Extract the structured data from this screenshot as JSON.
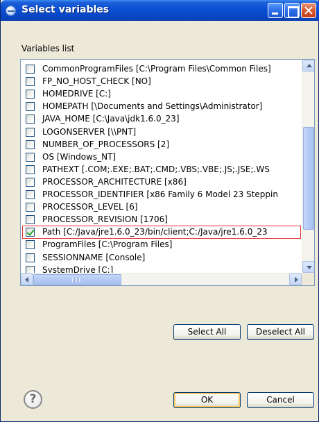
{
  "window": {
    "title": "Select variables"
  },
  "list": {
    "label": "Variables list",
    "items": [
      {
        "text": "CommonProgramFiles [C:\\Program Files\\Common Files]",
        "checked": false
      },
      {
        "text": "FP_NO_HOST_CHECK [NO]",
        "checked": false
      },
      {
        "text": "HOMEDRIVE [C:]",
        "checked": false
      },
      {
        "text": "HOMEPATH [\\Documents and Settings\\Administrator]",
        "checked": false
      },
      {
        "text": "JAVA_HOME [C:\\Java\\jdk1.6.0_23]",
        "checked": false
      },
      {
        "text": "LOGONSERVER [\\\\PNT]",
        "checked": false
      },
      {
        "text": "NUMBER_OF_PROCESSORS [2]",
        "checked": false
      },
      {
        "text": "OS [Windows_NT]",
        "checked": false
      },
      {
        "text": "PATHEXT [.COM;.EXE;.BAT;.CMD;.VBS;.VBE;.JS;.JSE;.WS",
        "checked": false
      },
      {
        "text": "PROCESSOR_ARCHITECTURE [x86]",
        "checked": false
      },
      {
        "text": "PROCESSOR_IDENTIFIER [x86 Family 6 Model 23 Steppin",
        "checked": false
      },
      {
        "text": "PROCESSOR_LEVEL [6]",
        "checked": false
      },
      {
        "text": "PROCESSOR_REVISION [1706]",
        "checked": false
      },
      {
        "text": "Path [C:/Java/jre1.6.0_23/bin/client;C:/Java/jre1.6.0_23",
        "checked": true
      },
      {
        "text": "ProgramFiles [C:\\Program Files]",
        "checked": false
      },
      {
        "text": "SESSIONNAME [Console]",
        "checked": false
      },
      {
        "text": "SystemDrive [C:]",
        "checked": false
      }
    ]
  },
  "buttons": {
    "select_all": "Select All",
    "deselect_all": "Deselect All",
    "ok": "OK",
    "cancel": "Cancel",
    "help": "?"
  }
}
